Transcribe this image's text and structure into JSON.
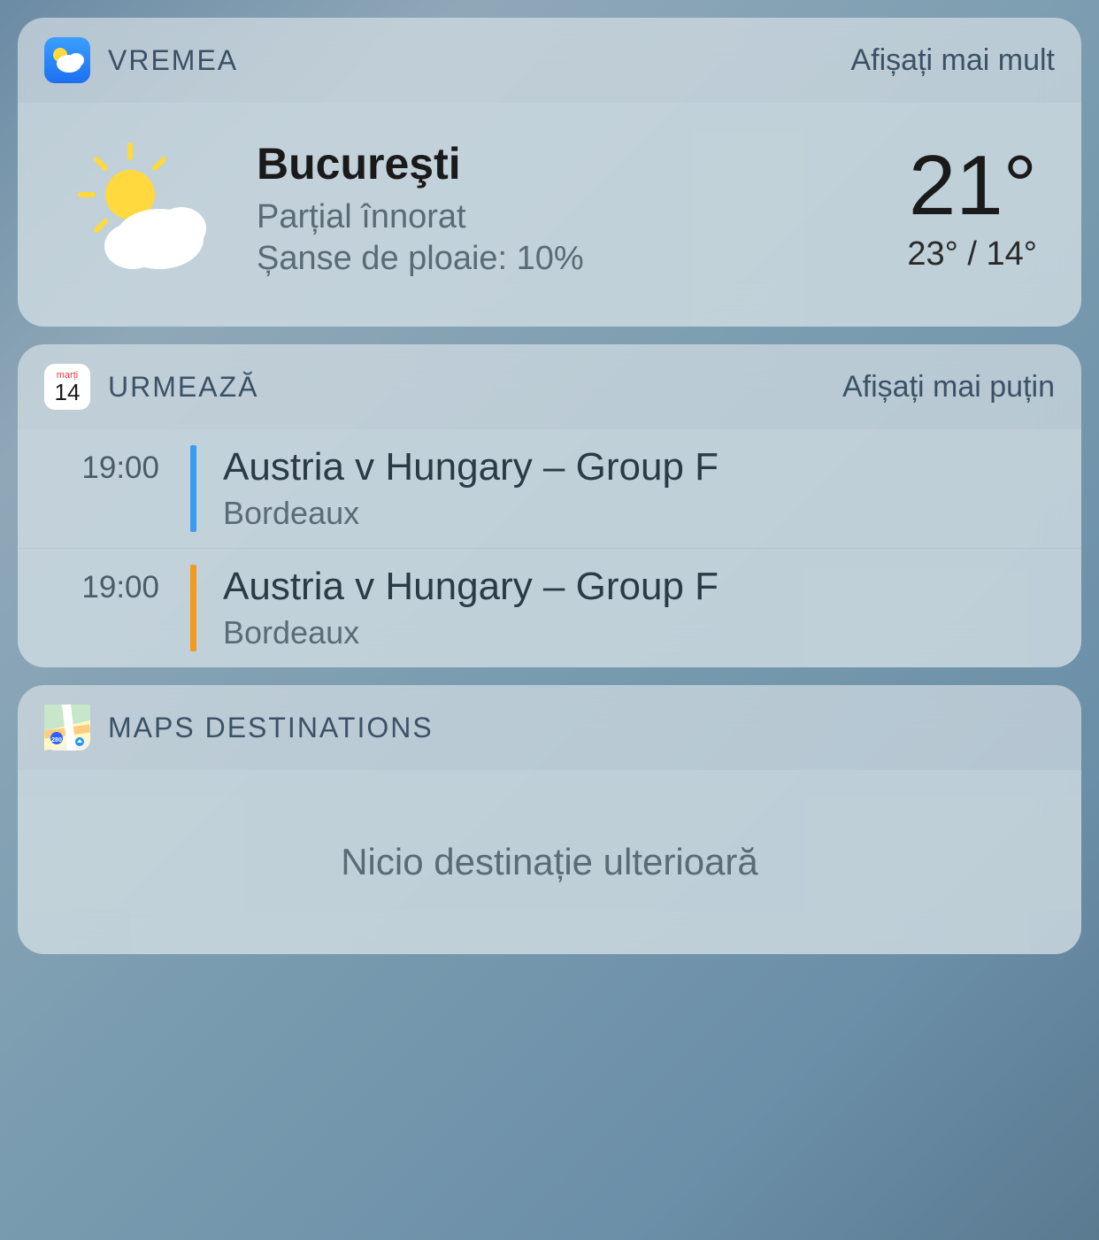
{
  "weather": {
    "widget_title": "VREMEA",
    "show_more": "Afișați mai mult",
    "city": "Bucureşti",
    "condition": "Parțial înnorat",
    "rain_chance": "Șanse de ploaie: 10%",
    "temperature": "21°",
    "high_low": "23° / 14°"
  },
  "upnext": {
    "widget_title": "URMEAZĂ",
    "show_less": "Afișați mai puțin",
    "calendar_day_label": "marți",
    "calendar_day_number": "14",
    "events": [
      {
        "time": "19:00",
        "title": "Austria v Hungary – Group F",
        "location": "Bordeaux",
        "color": "blue"
      },
      {
        "time": "19:00",
        "title": "Austria v Hungary – Group F",
        "location": "Bordeaux",
        "color": "orange"
      }
    ]
  },
  "maps": {
    "widget_title": "MAPS DESTINATIONS",
    "empty_state": "Nicio destinație ulterioară"
  }
}
